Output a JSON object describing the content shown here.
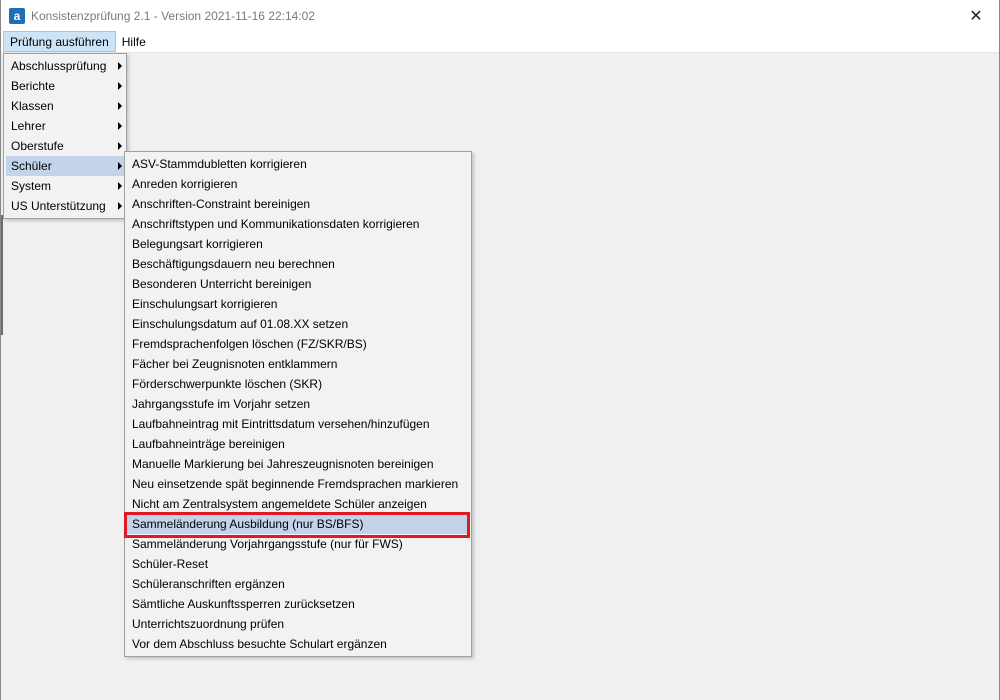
{
  "window": {
    "title": "Konsistenzprüfung 2.1 - Version 2021-11-16 22:14:02",
    "app_icon_letter": "a",
    "close_glyph": "✕"
  },
  "menubar": {
    "items": [
      {
        "label": "Prüfung ausführen",
        "active": true
      },
      {
        "label": "Hilfe",
        "active": false
      }
    ]
  },
  "main_menu": {
    "items": [
      {
        "label": "Abschlussprüfung"
      },
      {
        "label": "Berichte"
      },
      {
        "label": "Klassen"
      },
      {
        "label": "Lehrer"
      },
      {
        "label": "Oberstufe"
      },
      {
        "label": "Schüler",
        "hover": true
      },
      {
        "label": "System"
      },
      {
        "label": "US Unterstützung"
      }
    ]
  },
  "sub_menu": {
    "items": [
      {
        "label": "ASV-Stammdubletten korrigieren"
      },
      {
        "label": "Anreden korrigieren"
      },
      {
        "label": "Anschriften-Constraint bereinigen"
      },
      {
        "label": "Anschriftstypen und Kommunikationsdaten korrigieren"
      },
      {
        "label": "Belegungsart korrigieren"
      },
      {
        "label": "Beschäftigungsdauern neu berechnen"
      },
      {
        "label": "Besonderen Unterricht bereinigen"
      },
      {
        "label": "Einschulungsart korrigieren"
      },
      {
        "label": "Einschulungsdatum auf 01.08.XX setzen"
      },
      {
        "label": "Fremdsprachenfolgen löschen (FZ/SKR/BS)"
      },
      {
        "label": "Fächer bei Zeugnisnoten entklammern"
      },
      {
        "label": "Förderschwerpunkte löschen (SKR)"
      },
      {
        "label": "Jahrgangsstufe im Vorjahr setzen"
      },
      {
        "label": "Laufbahneintrag mit Eintrittsdatum versehen/hinzufügen"
      },
      {
        "label": "Laufbahneinträge bereinigen"
      },
      {
        "label": "Manuelle Markierung bei Jahreszeugnisnoten bereinigen"
      },
      {
        "label": "Neu einsetzende spät beginnende Fremdsprachen markieren"
      },
      {
        "label": "Nicht am Zentralsystem angemeldete Schüler anzeigen"
      },
      {
        "label": "Sammeländerung Ausbildung (nur BS/BFS)",
        "hover": true,
        "highlighted": true
      },
      {
        "label": "Sammeländerung Vorjahrgangsstufe (nur für FWS)"
      },
      {
        "label": "Schüler-Reset"
      },
      {
        "label": "Schüleranschriften ergänzen"
      },
      {
        "label": "Sämtliche Auskunftssperren zurücksetzen"
      },
      {
        "label": "Unterrichtszuordnung prüfen"
      },
      {
        "label": "Vor dem Abschluss besuchte Schulart ergänzen"
      }
    ]
  },
  "colors": {
    "hover": "#c3d3ea",
    "highlight_border": "#e01a22",
    "menubar_active": "#cce4f7"
  }
}
